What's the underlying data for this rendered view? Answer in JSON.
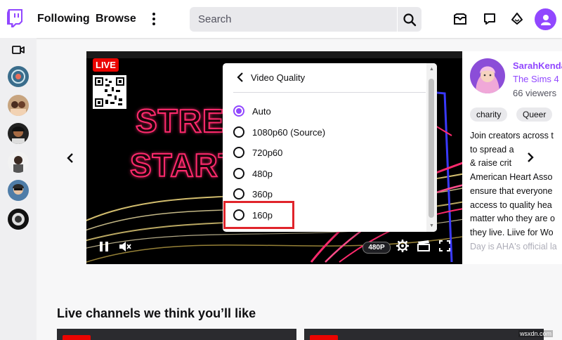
{
  "nav": {
    "following": "Following",
    "browse": "Browse",
    "search_placeholder": "Search"
  },
  "player": {
    "live_label": "LIVE",
    "stream_text_line1": "STRE",
    "stream_text_line2": "START",
    "quality_badge": "480P"
  },
  "quality_menu": {
    "title": "Video Quality",
    "options": [
      {
        "label": "Auto",
        "selected": true
      },
      {
        "label": "1080p60 (Source)",
        "selected": false
      },
      {
        "label": "720p60",
        "selected": false
      },
      {
        "label": "480p",
        "selected": false
      },
      {
        "label": "360p",
        "selected": false
      },
      {
        "label": "160p",
        "selected": false
      }
    ]
  },
  "channel": {
    "name": "SarahKenda",
    "game": "The Sims 4",
    "viewers": "66 viewers",
    "tags": [
      "charity",
      "Queer"
    ],
    "description_lines": [
      "Join creators across t",
      "to spread a",
      "& raise crit",
      "American Heart Asso",
      "ensure that everyone",
      "access to quality hea",
      "matter who they are o",
      "they live. Liive for Wo",
      "Day is AHA's official la"
    ]
  },
  "section": {
    "title": "Live channels we think you’ll like"
  },
  "watermark": "wsxdn.com",
  "colors": {
    "brand": "#9147ff",
    "live": "#eb0400",
    "highlight": "#e0242b"
  }
}
